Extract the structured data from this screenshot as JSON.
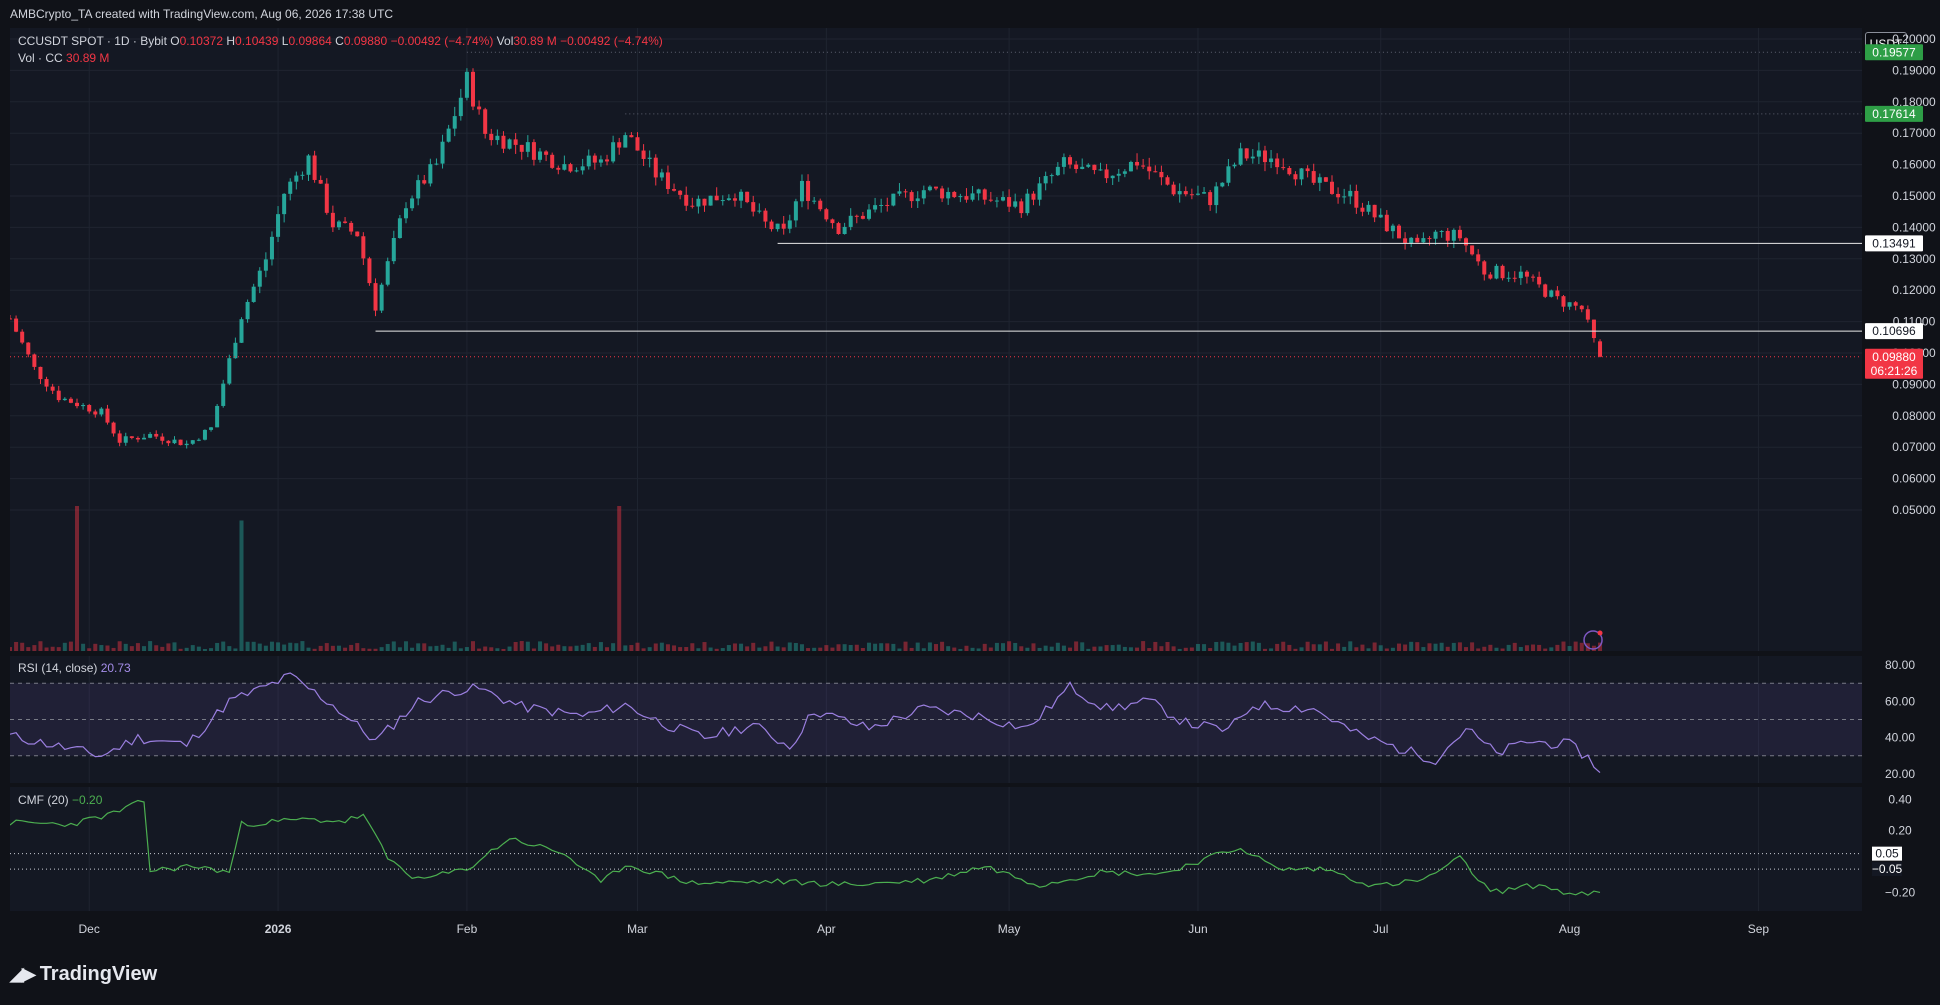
{
  "caption": "AMBCrypto_TA created with TradingView.com, Aug 06, 2026 17:38 UTC",
  "currency": "USDT",
  "brand": "TradingView",
  "colors": {
    "up": "#26a69a",
    "down": "#f23645",
    "grid": "#1f2430",
    "bg": "#141823",
    "rsi": "#9b7fe0",
    "cmf": "#4caf50",
    "green_tag": "#2e9e46"
  },
  "legend": {
    "symbol": "CCUSDT SPOT · 1D · Bybit",
    "o_label": "O",
    "o": "0.10372",
    "h_label": "H",
    "h": "0.10439",
    "l_label": "L",
    "l": "0.09864",
    "c_label": "C",
    "c": "0.09880",
    "change": "−0.00492 (−4.74%)",
    "vol_label": "Vol",
    "vol": "30.89 M",
    "vol_change": "−0.00492 (−4.74%)",
    "vol_line_label": "Vol · CC",
    "vol_line_value": "30.89 M"
  },
  "rsi_legend": {
    "label": "RSI (14, close)",
    "value": "20.73"
  },
  "cmf_legend": {
    "label": "CMF (20)",
    "value": "−0.20"
  },
  "chart_data": [
    {
      "type": "candlestick",
      "x_ticks": [
        "Dec",
        "2026",
        "Feb",
        "Mar",
        "Apr",
        "May",
        "Jun",
        "Jul",
        "Aug",
        "Sep"
      ],
      "x_tick_dates": [
        "2025-12-01",
        "2026-01-01",
        "2026-02-01",
        "2026-03-01",
        "2026-04-01",
        "2026-05-01",
        "2026-06-01",
        "2026-07-01",
        "2026-08-01",
        "2026-09-01"
      ],
      "x_range": [
        "2025-11-18",
        "2026-09-18"
      ],
      "y_ticks": [
        "0.20000",
        "0.19000",
        "0.18000",
        "0.17000",
        "0.16000",
        "0.15000",
        "0.14000",
        "0.13000",
        "0.12000",
        "0.11000",
        "0.10000",
        "0.09000",
        "0.08000",
        "0.07000",
        "0.06000",
        "0.05000"
      ],
      "ylim": [
        0.0465,
        0.2035
      ],
      "grid": true,
      "price_tags": [
        {
          "text": "0.19577",
          "value": 0.19577,
          "style": "green"
        },
        {
          "text": "0.17614",
          "value": 0.17614,
          "style": "green"
        },
        {
          "text": "0.13491",
          "value": 0.13491,
          "style": "white"
        },
        {
          "text": "0.10696",
          "value": 0.10696,
          "style": "white"
        },
        {
          "text": "0.09880",
          "text2": "06:21:26",
          "value": 0.0988,
          "style": "red"
        }
      ],
      "horizontal_lines": [
        {
          "value": 0.13491,
          "from": "2026-03-24",
          "style": "solid"
        },
        {
          "value": 0.10696,
          "from": "2026-01-17",
          "style": "solid"
        },
        {
          "value": 0.19577,
          "from": "2026-02-01",
          "style": "dotted"
        },
        {
          "value": 0.17614,
          "from": "2026-02-27",
          "style": "dotted"
        }
      ],
      "close_anchors": [
        [
          "2025-11-18",
          0.111
        ],
        [
          "2025-11-22",
          0.095
        ],
        [
          "2025-11-26",
          0.086
        ],
        [
          "2025-12-03",
          0.081
        ],
        [
          "2025-12-06",
          0.072
        ],
        [
          "2025-12-11",
          0.074
        ],
        [
          "2025-12-17",
          0.071
        ],
        [
          "2025-12-21",
          0.076
        ],
        [
          "2025-12-26",
          0.112
        ],
        [
          "2025-12-30",
          0.13
        ],
        [
          "2026-01-02",
          0.151
        ],
        [
          "2026-01-06",
          0.162
        ],
        [
          "2026-01-10",
          0.141
        ],
        [
          "2026-01-14",
          0.138
        ],
        [
          "2026-01-17",
          0.115
        ],
        [
          "2026-01-22",
          0.148
        ],
        [
          "2026-01-27",
          0.16
        ],
        [
          "2026-02-01",
          0.187
        ],
        [
          "2026-02-04",
          0.17
        ],
        [
          "2026-02-10",
          0.166
        ],
        [
          "2026-02-17",
          0.16
        ],
        [
          "2026-02-23",
          0.161
        ],
        [
          "2026-02-27",
          0.17
        ],
        [
          "2026-03-04",
          0.157
        ],
        [
          "2026-03-10",
          0.148
        ],
        [
          "2026-03-17",
          0.151
        ],
        [
          "2026-03-22",
          0.141
        ],
        [
          "2026-03-25",
          0.138
        ],
        [
          "2026-03-28",
          0.153
        ],
        [
          "2026-04-03",
          0.14
        ],
        [
          "2026-04-09",
          0.146
        ],
        [
          "2026-04-17",
          0.152
        ],
        [
          "2026-04-25",
          0.15
        ],
        [
          "2026-05-03",
          0.147
        ],
        [
          "2026-05-10",
          0.16
        ],
        [
          "2026-05-16",
          0.156
        ],
        [
          "2026-05-22",
          0.161
        ],
        [
          "2026-05-28",
          0.152
        ],
        [
          "2026-06-03",
          0.149
        ],
        [
          "2026-06-08",
          0.163
        ],
        [
          "2026-06-14",
          0.162
        ],
        [
          "2026-06-20",
          0.154
        ],
        [
          "2026-06-26",
          0.15
        ],
        [
          "2026-07-01",
          0.142
        ],
        [
          "2026-07-07",
          0.133
        ],
        [
          "2026-07-10",
          0.138
        ],
        [
          "2026-07-14",
          0.137
        ],
        [
          "2026-07-18",
          0.126
        ],
        [
          "2026-07-24",
          0.125
        ],
        [
          "2026-07-30",
          0.117
        ],
        [
          "2026-08-03",
          0.114
        ],
        [
          "2026-08-05",
          0.1037
        ],
        [
          "2026-08-06",
          0.0988
        ]
      ],
      "ohlc_last": {
        "date": "2026-08-06",
        "o": 0.10372,
        "h": 0.10439,
        "l": 0.09864,
        "c": 0.0988
      },
      "volume_spikes": [
        {
          "date": "2025-11-29",
          "value": 1.0,
          "dir": "up"
        },
        {
          "date": "2025-12-26",
          "value": 0.9,
          "dir": "up"
        },
        {
          "date": "2026-02-26",
          "value": 1.0,
          "dir": "down"
        }
      ],
      "volume_max_label": "scale"
    },
    {
      "type": "line",
      "title": "RSI (14, close)",
      "y_ticks": [
        "80.00",
        "60.00",
        "40.00",
        "20.00"
      ],
      "ylim": [
        15,
        85
      ],
      "bands": [
        70,
        50,
        30
      ],
      "last_value": 20.73,
      "anchors": [
        [
          "2025-11-18",
          41
        ],
        [
          "2025-11-25",
          36
        ],
        [
          "2025-12-03",
          30
        ],
        [
          "2025-12-09",
          40
        ],
        [
          "2025-12-17",
          36
        ],
        [
          "2025-12-24",
          60
        ],
        [
          "2025-12-30",
          68
        ],
        [
          "2026-01-03",
          74
        ],
        [
          "2026-01-10",
          58
        ],
        [
          "2026-01-17",
          38
        ],
        [
          "2026-01-24",
          60
        ],
        [
          "2026-01-30",
          66
        ],
        [
          "2026-02-03",
          67
        ],
        [
          "2026-02-10",
          57
        ],
        [
          "2026-02-20",
          52
        ],
        [
          "2026-02-27",
          58
        ],
        [
          "2026-03-05",
          48
        ],
        [
          "2026-03-12",
          40
        ],
        [
          "2026-03-20",
          47
        ],
        [
          "2026-03-26",
          35
        ],
        [
          "2026-03-30",
          55
        ],
        [
          "2026-04-08",
          45
        ],
        [
          "2026-04-17",
          56
        ],
        [
          "2026-04-26",
          52
        ],
        [
          "2026-05-04",
          45
        ],
        [
          "2026-05-11",
          68
        ],
        [
          "2026-05-17",
          56
        ],
        [
          "2026-05-24",
          60
        ],
        [
          "2026-05-30",
          48
        ],
        [
          "2026-06-06",
          44
        ],
        [
          "2026-06-10",
          58
        ],
        [
          "2026-06-20",
          56
        ],
        [
          "2026-06-27",
          42
        ],
        [
          "2026-07-04",
          34
        ],
        [
          "2026-07-10",
          28
        ],
        [
          "2026-07-15",
          45
        ],
        [
          "2026-07-20",
          31
        ],
        [
          "2026-07-25",
          38
        ],
        [
          "2026-08-01",
          36
        ],
        [
          "2026-08-04",
          29
        ],
        [
          "2026-08-06",
          20.73
        ]
      ]
    },
    {
      "type": "line",
      "title": "CMF (20)",
      "y_ticks": [
        "0.40",
        "0.20",
        "−0.20"
      ],
      "ylim": [
        -0.32,
        0.48
      ],
      "bands": [
        0.05,
        -0.05
      ],
      "band_labels": [
        "0.05",
        "−0.05"
      ],
      "last_value": -0.2,
      "anchors": [
        [
          "2025-11-18",
          0.25
        ],
        [
          "2025-11-28",
          0.24
        ],
        [
          "2025-12-05",
          0.31
        ],
        [
          "2025-12-10",
          0.39
        ],
        [
          "2025-12-11",
          -0.06
        ],
        [
          "2025-12-18",
          -0.03
        ],
        [
          "2025-12-24",
          -0.07
        ],
        [
          "2025-12-26",
          0.24
        ],
        [
          "2026-01-05",
          0.27
        ],
        [
          "2026-01-12",
          0.26
        ],
        [
          "2026-01-15",
          0.3
        ],
        [
          "2026-01-19",
          0.02
        ],
        [
          "2026-01-24",
          -0.12
        ],
        [
          "2026-02-01",
          -0.05
        ],
        [
          "2026-02-08",
          0.15
        ],
        [
          "2026-02-17",
          0.05
        ],
        [
          "2026-02-23",
          -0.14
        ],
        [
          "2026-02-27",
          -0.02
        ],
        [
          "2026-03-10",
          -0.14
        ],
        [
          "2026-03-24",
          -0.13
        ],
        [
          "2026-04-05",
          -0.15
        ],
        [
          "2026-04-18",
          -0.12
        ],
        [
          "2026-04-27",
          -0.03
        ],
        [
          "2026-05-06",
          -0.15
        ],
        [
          "2026-05-16",
          -0.07
        ],
        [
          "2026-05-26",
          -0.08
        ],
        [
          "2026-06-01",
          0.0
        ],
        [
          "2026-06-08",
          0.09
        ],
        [
          "2026-06-14",
          -0.05
        ],
        [
          "2026-06-22",
          -0.05
        ],
        [
          "2026-06-30",
          -0.16
        ],
        [
          "2026-07-08",
          -0.12
        ],
        [
          "2026-07-14",
          0.02
        ],
        [
          "2026-07-19",
          -0.2
        ],
        [
          "2026-07-27",
          -0.15
        ],
        [
          "2026-08-02",
          -0.22
        ],
        [
          "2026-08-06",
          -0.2
        ]
      ]
    }
  ]
}
